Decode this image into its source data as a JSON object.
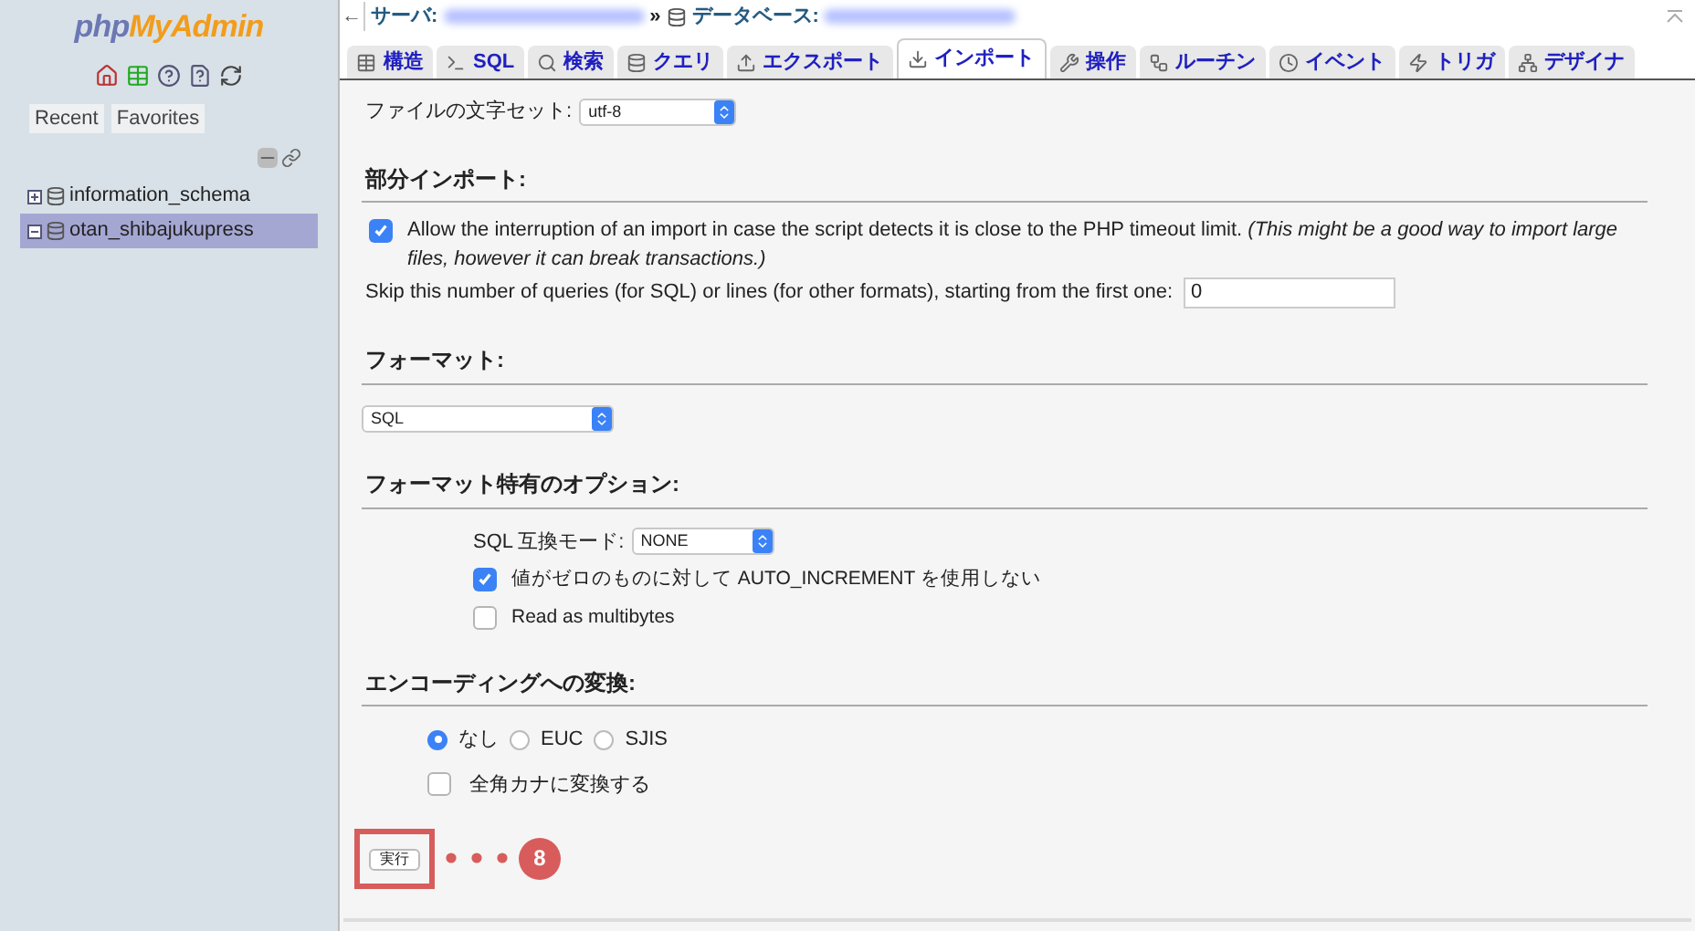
{
  "sidebar": {
    "logo": {
      "part_1": "php",
      "part_2": "MyAdmin"
    },
    "tabs": [
      {
        "label": "Recent"
      },
      {
        "label": "Favorites"
      }
    ],
    "databases": [
      {
        "name": "information_schema",
        "expanded": false,
        "selected": false
      },
      {
        "name": "otan_shibajukupress",
        "expanded": true,
        "selected": true
      }
    ]
  },
  "breadcrumb": {
    "back": "←",
    "server_label": "サーバ:",
    "separator": "»",
    "database_label": "データベース:"
  },
  "tabs": [
    {
      "label": "構造",
      "selected": false
    },
    {
      "label": "SQL",
      "selected": false
    },
    {
      "label": "検索",
      "selected": false
    },
    {
      "label": "クエリ",
      "selected": false
    },
    {
      "label": "エクスポート",
      "selected": false
    },
    {
      "label": "インポート",
      "selected": true
    },
    {
      "label": "操作",
      "selected": false
    },
    {
      "label": "ルーチン",
      "selected": false
    },
    {
      "label": "イベント",
      "selected": false
    },
    {
      "label": "トリガ",
      "selected": false
    },
    {
      "label": "デザイナ",
      "selected": false
    }
  ],
  "charset": {
    "label": "ファイルの文字セット:",
    "value": "utf-8"
  },
  "partial_import": {
    "title": "部分インポート:",
    "allow_interrupt": {
      "label": "Allow the interruption of an import in case the script detects it is close to the PHP timeout limit. *(This might be a good way to import large files, however it can break transactions.)*",
      "checked": true
    },
    "skip": {
      "label": "Skip this number of queries (for SQL) or lines (for other formats), starting from the first one:",
      "value": "0"
    }
  },
  "format": {
    "title": "フォーマット:",
    "value": "SQL"
  },
  "format_options": {
    "title": "フォーマット特有のオプション:",
    "compat_label": "SQL 互換モード:",
    "compat_value": "NONE",
    "options": [
      {
        "label": "値がゼロのものに対して AUTO_INCREMENT を使用しない",
        "checked": true
      },
      {
        "label": "Read as multibytes",
        "checked": false
      }
    ]
  },
  "encoding": {
    "title": "エンコーディングへの変換:",
    "radios": [
      {
        "label": "なし",
        "selected": true
      },
      {
        "label": "EUC",
        "selected": false
      },
      {
        "label": "SJIS",
        "selected": false
      }
    ],
    "kana": {
      "label": "全角カナに変換する",
      "checked": false
    }
  },
  "submit": {
    "label": "実行",
    "step": "8"
  }
}
